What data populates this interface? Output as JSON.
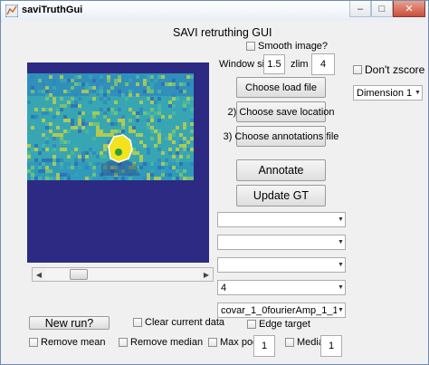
{
  "window": {
    "title": "saviTruthGui",
    "minimize": "–",
    "maximize": "□",
    "close": "✕"
  },
  "header": {
    "title": "SAVI retruthing GUI"
  },
  "controls": {
    "smooth_label": "Smooth image?",
    "window_size_label": "Window size",
    "window_size_value": "1.5",
    "zlim_label": "zlim",
    "zlim_value": "4",
    "dont_zscore_label": "Don't zscore",
    "dimension_value": "Dimension 1"
  },
  "buttons": {
    "load": "Choose load file",
    "save": "2) Choose save location",
    "annotations": "3) Choose annotations file",
    "annotate": "Annotate",
    "update": "Update GT",
    "new_run": "New run?"
  },
  "dropdowns": {
    "d1": "",
    "d2": "",
    "d3": "",
    "d4": "4",
    "d5": "covar_1_0fourierAmp_1_1..."
  },
  "options": {
    "clear_current": "Clear current data",
    "edge_target": "Edge target",
    "remove_mean": "Remove mean",
    "remove_median": "Remove median",
    "max_pool": "Max pool",
    "max_pool_value": "1",
    "median": "Median",
    "median_value": "1"
  },
  "colors": {
    "heatmap_background": "#2c2a82",
    "accent_blue": "#3a6fb0"
  },
  "icons": {
    "app_icon": "matlab-figure-icon"
  }
}
